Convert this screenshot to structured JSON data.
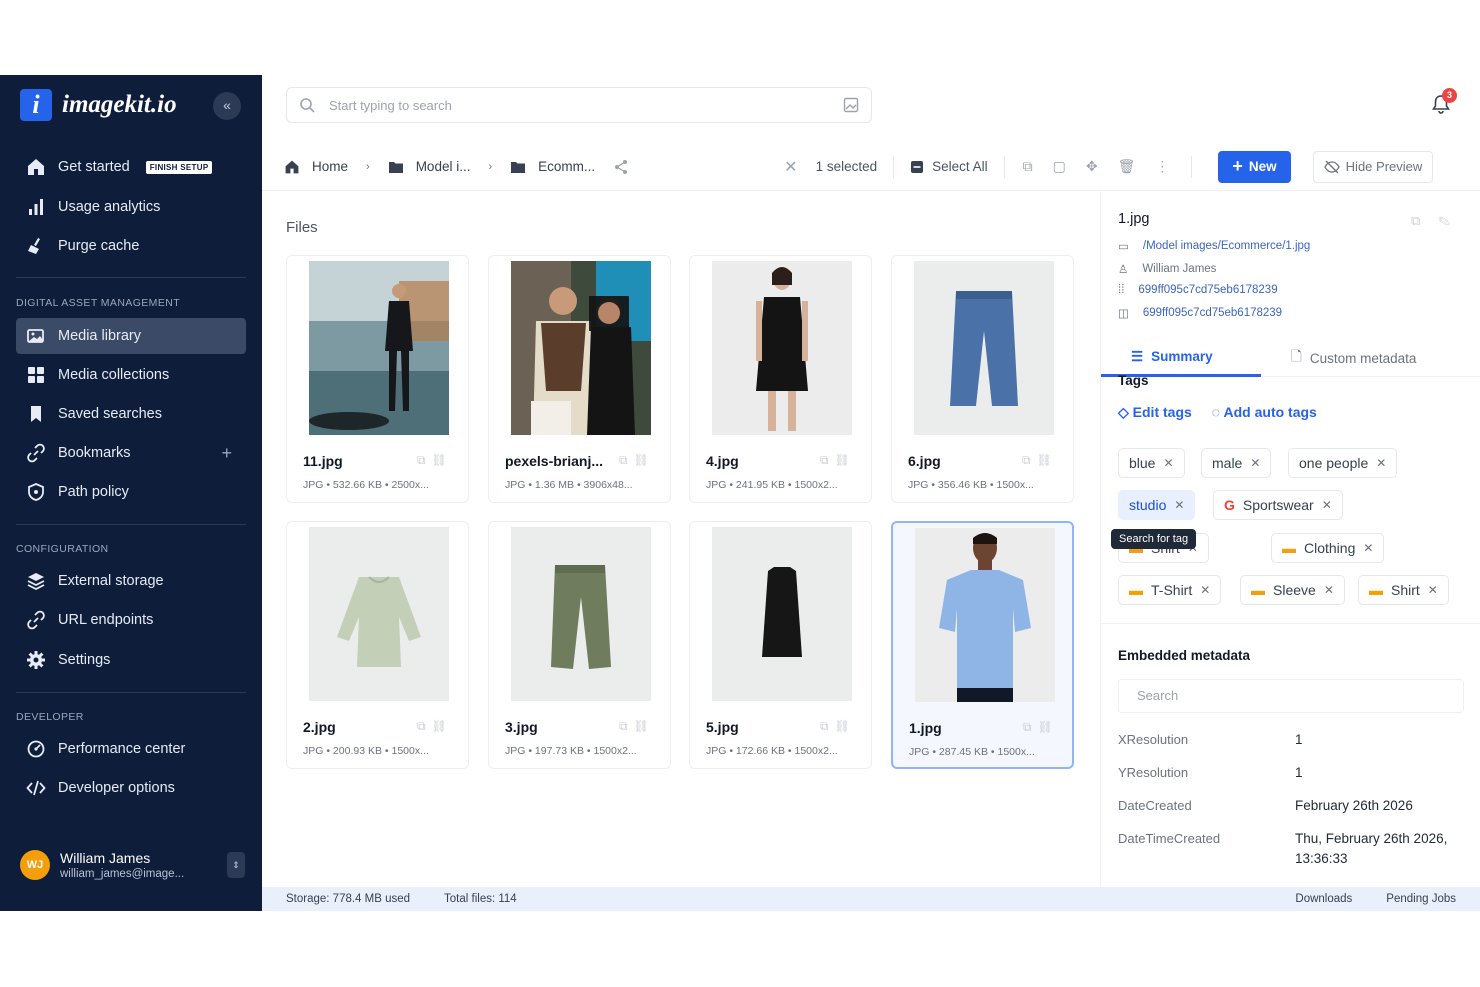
{
  "brand": {
    "name": "imagekit.io",
    "mark": "i"
  },
  "sidebar": {
    "collapse_icon": "«",
    "top_items": [
      {
        "label": "Get started",
        "badge": "FINISH SETUP"
      },
      {
        "label": "Usage analytics"
      },
      {
        "label": "Purge cache"
      }
    ],
    "dam_label": "DIGITAL ASSET MANAGEMENT",
    "dam_items": [
      {
        "label": "Media library",
        "active": true
      },
      {
        "label": "Media collections"
      },
      {
        "label": "Saved searches"
      },
      {
        "label": "Bookmarks"
      },
      {
        "label": "Path policy"
      }
    ],
    "config_label": "CONFIGURATION",
    "config_items": [
      {
        "label": "External storage"
      },
      {
        "label": "URL endpoints"
      },
      {
        "label": "Settings"
      }
    ],
    "dev_label": "DEVELOPER",
    "dev_items": [
      {
        "label": "Performance center"
      },
      {
        "label": "Developer options"
      }
    ],
    "user": {
      "initials": "WJ",
      "name": "William James",
      "email": "william_james@image..."
    }
  },
  "search": {
    "placeholder": "Start typing to search"
  },
  "notifications": {
    "count": "3"
  },
  "toolbar": {
    "breadcrumb": [
      "Home",
      "Model i...",
      "Ecomm..."
    ],
    "selected_text": "1 selected",
    "select_all": "Select All",
    "new_label": "New",
    "hide_preview": "Hide Preview"
  },
  "files": {
    "title": "Files",
    "items": [
      {
        "name": "11.jpg",
        "meta": "JPG • 532.66 KB • 2500x..."
      },
      {
        "name": "pexels-brianj...",
        "meta": "JPG • 1.36 MB • 3906x48..."
      },
      {
        "name": "4.jpg",
        "meta": "JPG • 241.95 KB • 1500x2..."
      },
      {
        "name": "6.jpg",
        "meta": "JPG • 356.46 KB • 1500x..."
      },
      {
        "name": "2.jpg",
        "meta": "JPG • 200.93 KB • 1500x..."
      },
      {
        "name": "3.jpg",
        "meta": "JPG • 197.73 KB • 1500x2..."
      },
      {
        "name": "5.jpg",
        "meta": "JPG • 172.66 KB • 1500x2..."
      },
      {
        "name": "1.jpg",
        "meta": "JPG • 287.45 KB • 1500x...",
        "selected": true
      }
    ]
  },
  "preview": {
    "title": "1.jpg",
    "path": "/Model images/Ecommerce/1.jpg",
    "owner": "William James",
    "id1": "699ff095c7cd75eb6178239",
    "id2": "699ff095c7cd75eb6178239",
    "tabs": {
      "summary": "Summary",
      "custom": "Custom metadata"
    },
    "tags_heading": "Tags",
    "edit_tags": "Edit tags",
    "add_auto_tags": "Add auto tags",
    "tags": [
      "blue",
      "male",
      "one people",
      "studio",
      "Sportswear",
      "Shirt",
      "Clothing",
      "T-Shirt",
      "Sleeve",
      "Shirt"
    ],
    "tooltip": "Search for tag",
    "embedded_heading": "Embedded metadata",
    "meta_search_placeholder": "Search",
    "metadata": [
      {
        "key": "XResolution",
        "value": "1"
      },
      {
        "key": "YResolution",
        "value": "1"
      },
      {
        "key": "DateCreated",
        "value": "February 26th 2026"
      },
      {
        "key": "DateTimeCreated",
        "value": "Thu, February 26th 2026, 13:36:33"
      }
    ]
  },
  "status": {
    "storage": "Storage: 778.4 MB used",
    "total": "Total files: 114",
    "downloads": "Downloads",
    "pending": "Pending Jobs"
  },
  "colors": {
    "sidebar_bg": "#0e1d3a",
    "accent": "#2563eb",
    "badge": "#ef4444"
  }
}
